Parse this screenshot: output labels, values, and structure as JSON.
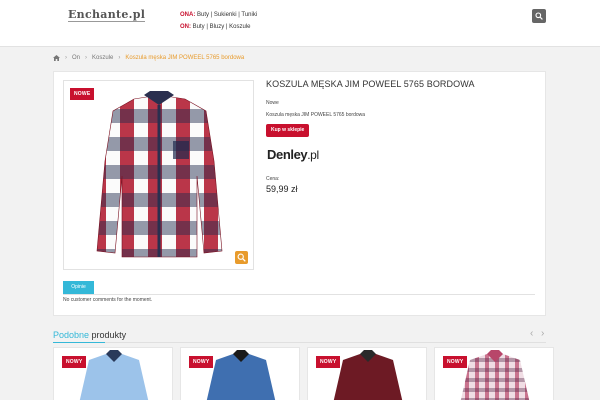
{
  "header": {
    "logo": "Enchante.pl",
    "nav": [
      {
        "label": "ONA:",
        "links": "Buty | Sukienki | Tuniki"
      },
      {
        "label": "ON:",
        "links": "Buty | Bluzy | Koszule"
      }
    ],
    "search_icon": "search-icon"
  },
  "breadcrumb": {
    "home_icon": "home-icon",
    "items": [
      "On",
      "Koszule"
    ],
    "current": "Koszula męska JIM POWEEL 5765 bordowa",
    "separator": "›"
  },
  "product": {
    "badge": "NOWE",
    "title": "KOSZULA MĘSKA JIM POWEEL 5765 BORDOWA",
    "condition": "Nowe",
    "short_description": "Koszula męska JIM POWEEL 5765 bordowa",
    "buy_button": "Kup w sklepie",
    "brand": {
      "name": "Denley",
      "suffix": ".pl"
    },
    "price_label": "Cena:",
    "price": "59,99 zł",
    "zoom_icon": "zoom-icon"
  },
  "tabs": {
    "active": "Opinie",
    "comments_text": "No customer comments for the moment."
  },
  "similar": {
    "title_accent": "Podobne",
    "title_rest": " produkty",
    "prev": "‹",
    "next": "›",
    "items": [
      {
        "badge": "NOWY",
        "color": "#9cc3ea"
      },
      {
        "badge": "NOWY",
        "color": "#3f6fb0"
      },
      {
        "badge": "NOWY",
        "color": "#6d1a24"
      },
      {
        "badge": "NOWY",
        "color": "#b8466a"
      }
    ]
  },
  "colors": {
    "accent_red": "#c8102e",
    "accent_blue": "#34b8d8",
    "accent_orange": "#e89b2c"
  }
}
